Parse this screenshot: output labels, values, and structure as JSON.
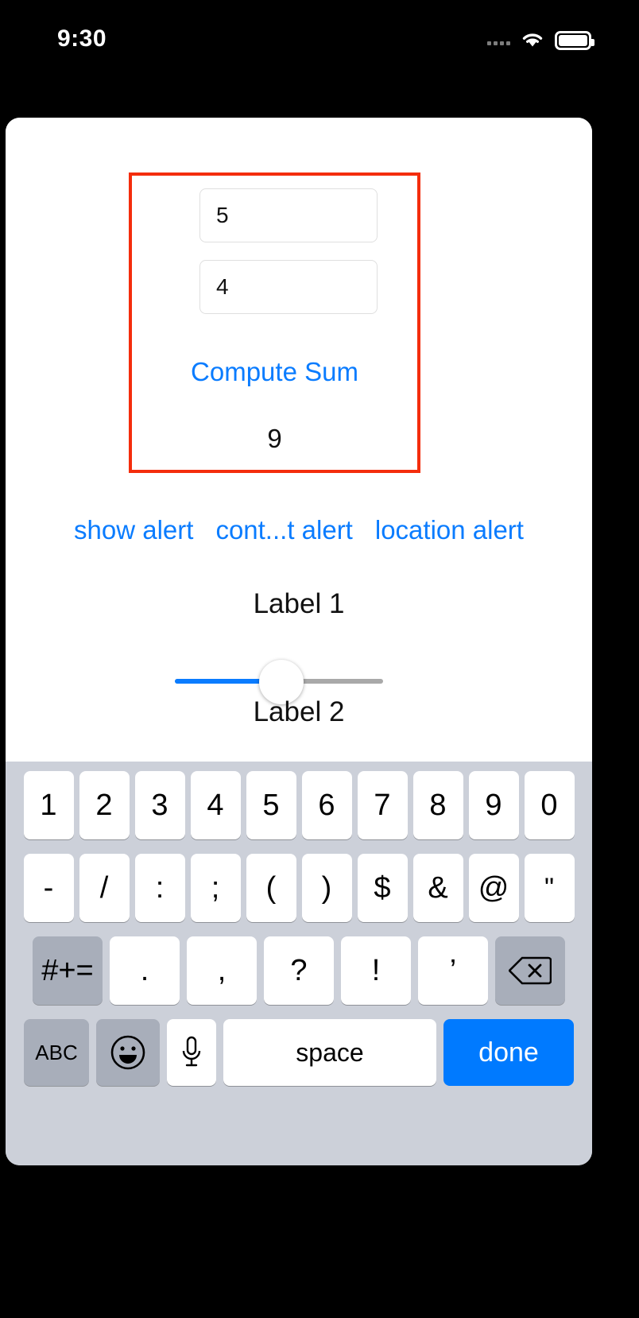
{
  "status_bar": {
    "time": "9:30",
    "signal_icon": "signal-dots-icon",
    "wifi_icon": "wifi-icon",
    "battery_icon": "battery-icon"
  },
  "app": {
    "form": {
      "field_a_value": "5",
      "field_b_value": "4",
      "field_placeholder": "",
      "compute_button_label": "Compute Sum",
      "result_value": "9",
      "highlight_color": "#f42d0c"
    },
    "alert_links": [
      {
        "label": "show alert"
      },
      {
        "label": "cont...t alert"
      },
      {
        "label": "location alert"
      }
    ],
    "slider": {
      "label_top": "Label 1",
      "label_bottom": "Label 2",
      "value_percent": 50,
      "fill_color": "#0a7cff",
      "track_color": "#a9a9a9"
    },
    "accent_color": "#0a7cff"
  },
  "keyboard": {
    "row1": [
      "1",
      "2",
      "3",
      "4",
      "5",
      "6",
      "7",
      "8",
      "9",
      "0"
    ],
    "row2": [
      "-",
      "/",
      ":",
      ";",
      "(",
      ")",
      "$",
      "&",
      "@",
      "\""
    ],
    "row3": {
      "symbols_key": "#+=",
      "keys": [
        ".",
        ",",
        "?",
        "!",
        "’"
      ],
      "backspace_icon": "backspace-icon"
    },
    "row4": {
      "abc_key": "ABC",
      "emoji_icon": "emoji-smiley-icon",
      "mic_icon": "microphone-icon",
      "space_key": "space",
      "done_key": "done",
      "done_color": "#007aff"
    }
  }
}
